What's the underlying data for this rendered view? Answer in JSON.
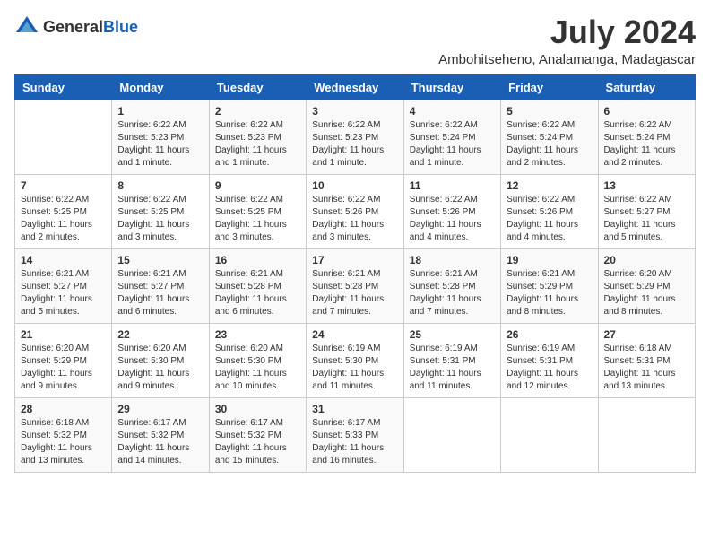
{
  "logo": {
    "text_general": "General",
    "text_blue": "Blue"
  },
  "header": {
    "month": "July 2024",
    "location": "Ambohitseheno, Analamanga, Madagascar"
  },
  "weekdays": [
    "Sunday",
    "Monday",
    "Tuesday",
    "Wednesday",
    "Thursday",
    "Friday",
    "Saturday"
  ],
  "weeks": [
    [
      {
        "day": "",
        "info": ""
      },
      {
        "day": "1",
        "info": "Sunrise: 6:22 AM\nSunset: 5:23 PM\nDaylight: 11 hours\nand 1 minute."
      },
      {
        "day": "2",
        "info": "Sunrise: 6:22 AM\nSunset: 5:23 PM\nDaylight: 11 hours\nand 1 minute."
      },
      {
        "day": "3",
        "info": "Sunrise: 6:22 AM\nSunset: 5:23 PM\nDaylight: 11 hours\nand 1 minute."
      },
      {
        "day": "4",
        "info": "Sunrise: 6:22 AM\nSunset: 5:24 PM\nDaylight: 11 hours\nand 1 minute."
      },
      {
        "day": "5",
        "info": "Sunrise: 6:22 AM\nSunset: 5:24 PM\nDaylight: 11 hours\nand 2 minutes."
      },
      {
        "day": "6",
        "info": "Sunrise: 6:22 AM\nSunset: 5:24 PM\nDaylight: 11 hours\nand 2 minutes."
      }
    ],
    [
      {
        "day": "7",
        "info": "Sunrise: 6:22 AM\nSunset: 5:25 PM\nDaylight: 11 hours\nand 2 minutes."
      },
      {
        "day": "8",
        "info": "Sunrise: 6:22 AM\nSunset: 5:25 PM\nDaylight: 11 hours\nand 3 minutes."
      },
      {
        "day": "9",
        "info": "Sunrise: 6:22 AM\nSunset: 5:25 PM\nDaylight: 11 hours\nand 3 minutes."
      },
      {
        "day": "10",
        "info": "Sunrise: 6:22 AM\nSunset: 5:26 PM\nDaylight: 11 hours\nand 3 minutes."
      },
      {
        "day": "11",
        "info": "Sunrise: 6:22 AM\nSunset: 5:26 PM\nDaylight: 11 hours\nand 4 minutes."
      },
      {
        "day": "12",
        "info": "Sunrise: 6:22 AM\nSunset: 5:26 PM\nDaylight: 11 hours\nand 4 minutes."
      },
      {
        "day": "13",
        "info": "Sunrise: 6:22 AM\nSunset: 5:27 PM\nDaylight: 11 hours\nand 5 minutes."
      }
    ],
    [
      {
        "day": "14",
        "info": "Sunrise: 6:21 AM\nSunset: 5:27 PM\nDaylight: 11 hours\nand 5 minutes."
      },
      {
        "day": "15",
        "info": "Sunrise: 6:21 AM\nSunset: 5:27 PM\nDaylight: 11 hours\nand 6 minutes."
      },
      {
        "day": "16",
        "info": "Sunrise: 6:21 AM\nSunset: 5:28 PM\nDaylight: 11 hours\nand 6 minutes."
      },
      {
        "day": "17",
        "info": "Sunrise: 6:21 AM\nSunset: 5:28 PM\nDaylight: 11 hours\nand 7 minutes."
      },
      {
        "day": "18",
        "info": "Sunrise: 6:21 AM\nSunset: 5:28 PM\nDaylight: 11 hours\nand 7 minutes."
      },
      {
        "day": "19",
        "info": "Sunrise: 6:21 AM\nSunset: 5:29 PM\nDaylight: 11 hours\nand 8 minutes."
      },
      {
        "day": "20",
        "info": "Sunrise: 6:20 AM\nSunset: 5:29 PM\nDaylight: 11 hours\nand 8 minutes."
      }
    ],
    [
      {
        "day": "21",
        "info": "Sunrise: 6:20 AM\nSunset: 5:29 PM\nDaylight: 11 hours\nand 9 minutes."
      },
      {
        "day": "22",
        "info": "Sunrise: 6:20 AM\nSunset: 5:30 PM\nDaylight: 11 hours\nand 9 minutes."
      },
      {
        "day": "23",
        "info": "Sunrise: 6:20 AM\nSunset: 5:30 PM\nDaylight: 11 hours\nand 10 minutes."
      },
      {
        "day": "24",
        "info": "Sunrise: 6:19 AM\nSunset: 5:30 PM\nDaylight: 11 hours\nand 11 minutes."
      },
      {
        "day": "25",
        "info": "Sunrise: 6:19 AM\nSunset: 5:31 PM\nDaylight: 11 hours\nand 11 minutes."
      },
      {
        "day": "26",
        "info": "Sunrise: 6:19 AM\nSunset: 5:31 PM\nDaylight: 11 hours\nand 12 minutes."
      },
      {
        "day": "27",
        "info": "Sunrise: 6:18 AM\nSunset: 5:31 PM\nDaylight: 11 hours\nand 13 minutes."
      }
    ],
    [
      {
        "day": "28",
        "info": "Sunrise: 6:18 AM\nSunset: 5:32 PM\nDaylight: 11 hours\nand 13 minutes."
      },
      {
        "day": "29",
        "info": "Sunrise: 6:17 AM\nSunset: 5:32 PM\nDaylight: 11 hours\nand 14 minutes."
      },
      {
        "day": "30",
        "info": "Sunrise: 6:17 AM\nSunset: 5:32 PM\nDaylight: 11 hours\nand 15 minutes."
      },
      {
        "day": "31",
        "info": "Sunrise: 6:17 AM\nSunset: 5:33 PM\nDaylight: 11 hours\nand 16 minutes."
      },
      {
        "day": "",
        "info": ""
      },
      {
        "day": "",
        "info": ""
      },
      {
        "day": "",
        "info": ""
      }
    ]
  ]
}
